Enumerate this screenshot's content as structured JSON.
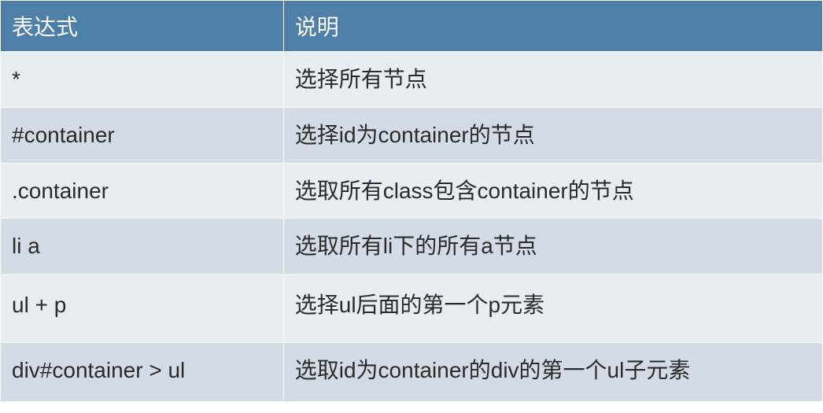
{
  "chart_data": {
    "type": "table",
    "headers": [
      "表达式",
      "说明"
    ],
    "rows": [
      {
        "expression": "*",
        "description": "选择所有节点"
      },
      {
        "expression": "#container",
        "description": "选择id为container的节点"
      },
      {
        "expression": ".container",
        "description": "选取所有class包含container的节点"
      },
      {
        "expression": "li a",
        "description": "选取所有li下的所有a节点"
      },
      {
        "expression": "ul + p",
        "description": "选择ul后面的第一个p元素"
      },
      {
        "expression": "div#container > ul",
        "description": "选取id为container的div的第一个ul子元素"
      }
    ]
  }
}
